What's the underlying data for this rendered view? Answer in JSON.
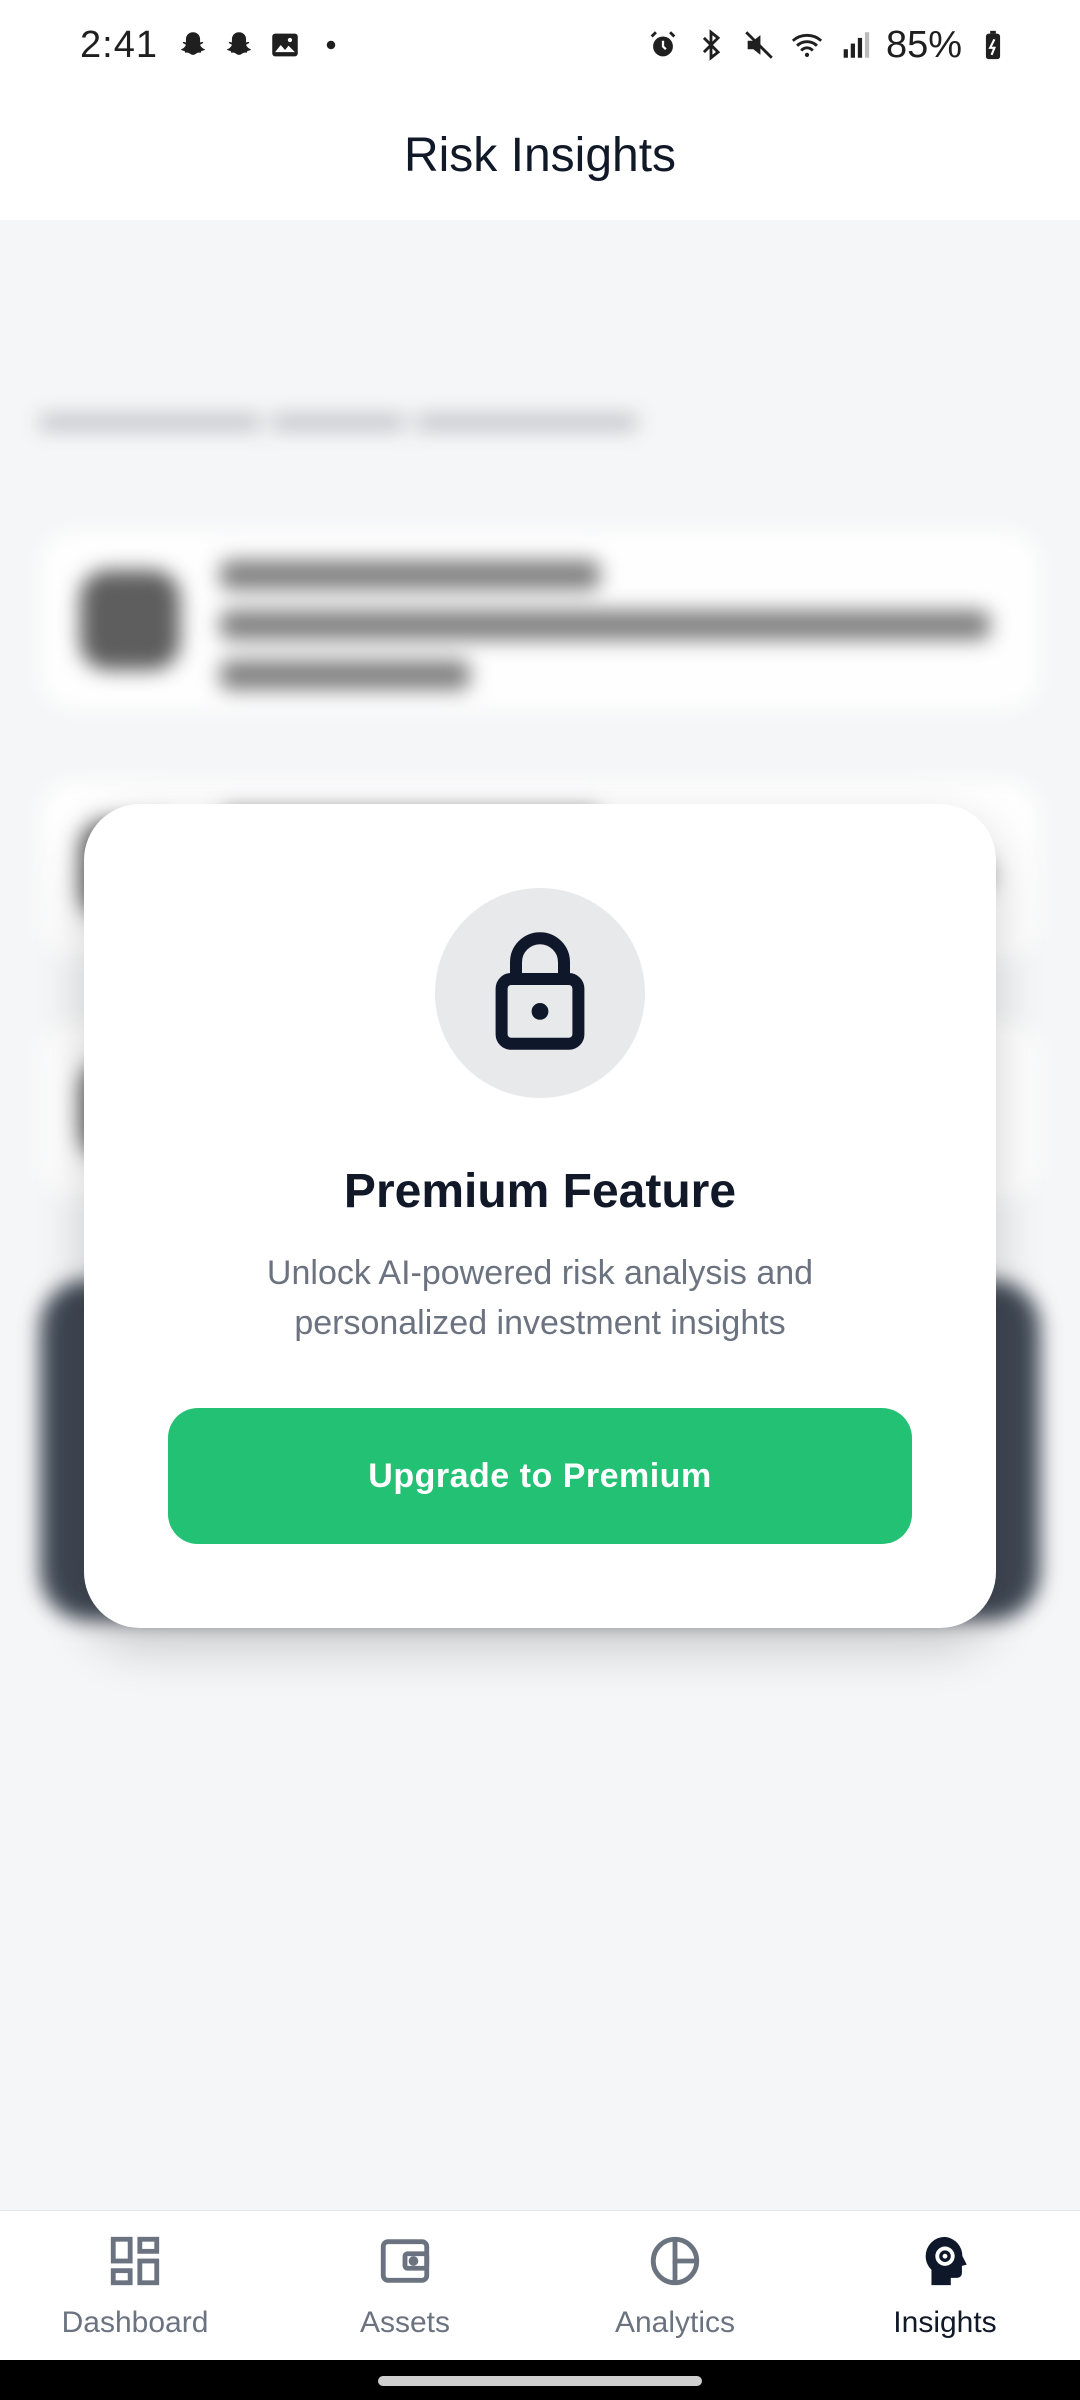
{
  "status_bar": {
    "time": "2:41",
    "battery": "85%",
    "left_icons": [
      "snapchat-icon",
      "snapchat-icon",
      "image-icon",
      "dot-icon"
    ],
    "right_icons": [
      "alarm-icon",
      "bluetooth-icon",
      "mute-icon",
      "wifi-icon",
      "signal-icon",
      "battery-icon"
    ]
  },
  "header": {
    "title": "Risk Insights"
  },
  "modal": {
    "icon": "lock-icon",
    "title": "Premium Feature",
    "description": "Unlock AI-powered risk analysis and personalized investment insights",
    "button_label": "Upgrade to Premium",
    "button_color": "#22c174"
  },
  "bottom_nav": {
    "items": [
      {
        "label": "Dashboard",
        "icon": "dashboard-icon",
        "active": false
      },
      {
        "label": "Assets",
        "icon": "wallet-icon",
        "active": false
      },
      {
        "label": "Analytics",
        "icon": "pie-chart-icon",
        "active": false
      },
      {
        "label": "Insights",
        "icon": "brain-gear-icon",
        "active": true
      }
    ]
  },
  "colors": {
    "accent": "#22c174",
    "text_primary": "#111827",
    "text_secondary": "#6b7280",
    "background": "#f5f6f8"
  }
}
